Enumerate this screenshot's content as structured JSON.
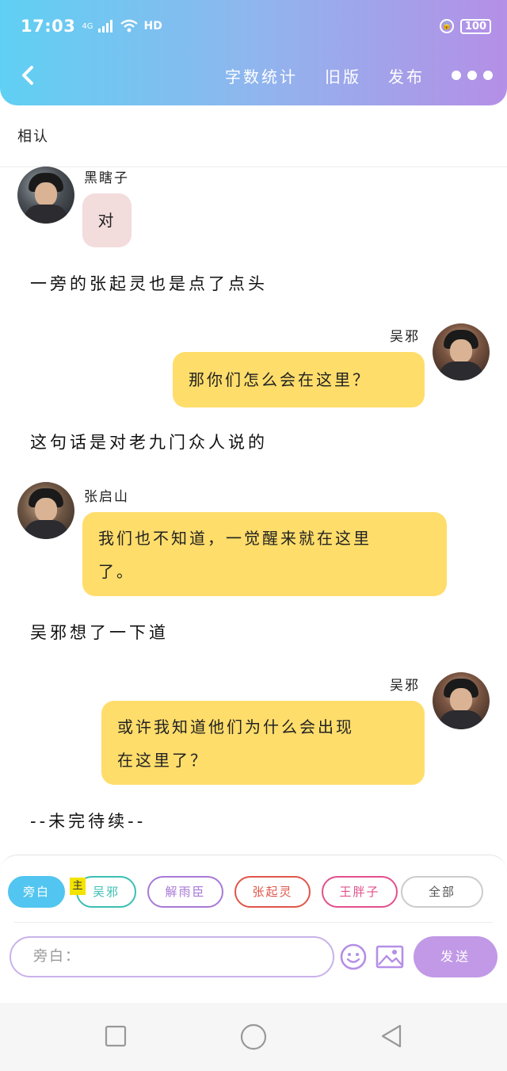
{
  "status_bar": {
    "time": "17:03",
    "network": "4G",
    "signal_icon": "signal-bars-icon",
    "wifi_icon": "wifi-icon",
    "hd": "HD",
    "battery": "100"
  },
  "header": {
    "actions": {
      "word_count": "字数统计",
      "old_version": "旧版",
      "publish": "发布"
    }
  },
  "chapter": {
    "title": "相认"
  },
  "messages": [
    {
      "type": "character",
      "side": "left",
      "name": "黑瞎子",
      "text": "对"
    },
    {
      "type": "narration",
      "text": "一旁的张起灵也是点了点头"
    },
    {
      "type": "character",
      "side": "right",
      "name": "吴邪",
      "text": "那你们怎么会在这里？"
    },
    {
      "type": "narration",
      "text": "这句话是对老九门众人说的"
    },
    {
      "type": "character",
      "side": "left",
      "name": "张启山",
      "text_line1": "我们也不知道，一觉醒来就在这里",
      "text_line2": "了。"
    },
    {
      "type": "narration",
      "text": "吴邪想了一下道"
    },
    {
      "type": "character",
      "side": "right",
      "name": "吴邪",
      "text_line1": "或许我知道他们为什么会出现",
      "text_line2": "在这里了？"
    },
    {
      "type": "narration",
      "text": "--未完待续--"
    }
  ],
  "composer": {
    "roles": [
      {
        "label": "旁白",
        "color": "#52c5f0",
        "active": true
      },
      {
        "label": "吴邪",
        "color": "#3bbfb3",
        "active": false
      },
      {
        "label": "解雨臣",
        "color": "#a77ad6",
        "active": false
      },
      {
        "label": "张起灵",
        "color": "#e0564a",
        "active": false
      },
      {
        "label": "王胖子",
        "color": "#e2508c",
        "active": false
      },
      {
        "label": "全部",
        "color": "#cccccc",
        "active": false
      }
    ],
    "main_tag": "主",
    "input_placeholder": "旁白：",
    "send_label": "发送"
  },
  "colors": {
    "header_gradient_start": "#5fd0f3",
    "header_gradient_end": "#b48fe6",
    "bubble_yellow": "#ffdd6b",
    "bubble_pink": "#f3dcdc",
    "send_button": "#c199e6"
  }
}
